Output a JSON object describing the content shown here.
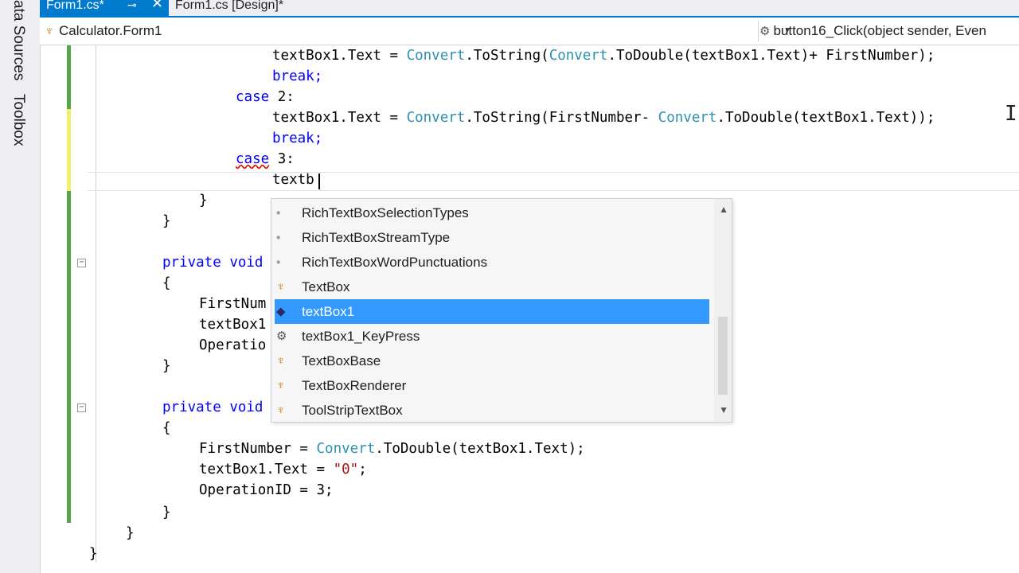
{
  "side_panel": {
    "tabs": [
      "ata Sources",
      "Toolbox"
    ]
  },
  "tabs": {
    "active_label": "Form1.cs*",
    "pin_icon": "pin-icon",
    "close_icon": "close-icon",
    "second_label": "Form1.cs [Design]*"
  },
  "nav": {
    "class_selector": "Calculator.Form1",
    "member_selector": "button16_Click(object sender, Even"
  },
  "code": {
    "l1a": "textBox1.Text = ",
    "l1b": "Convert",
    "l1c": ".ToString(",
    "l1d": "Convert",
    "l1e": ".ToDouble(textBox1.Text)+ FirstNumber);",
    "l2": "break;",
    "l3a": "case",
    "l3b": " 2:",
    "l4a": "textBox1.Text = ",
    "l4b": "Convert",
    "l4c": ".ToString(FirstNumber- ",
    "l4d": "Convert",
    "l4e": ".ToDouble(textBox1.Text));",
    "l5": "break;",
    "l6a": "case",
    "l6b": " 3:",
    "l7": "textb",
    "l8": "}",
    "l9": "}",
    "l10a": "private",
    "l10b": "void",
    "l11": "{",
    "l12": "FirstNum",
    "l13": "textBox1",
    "l14": "Operatio",
    "l15": "}",
    "l16a": "private",
    "l16b": "void",
    "l17": "{",
    "l18a": "FirstNumber = ",
    "l18b": "Convert",
    "l18c": ".ToDouble(textBox1.Text);",
    "l19a": "textBox1.Text = ",
    "l19b": "\"0\"",
    "l19c": ";",
    "l20": "OperationID = 3;",
    "l21": "}",
    "l22": "}",
    "l23": "}"
  },
  "completion": {
    "items": [
      {
        "label": "RichTextBoxSelectionTypes",
        "icon": "enum-icon",
        "glyph": "▪"
      },
      {
        "label": "RichTextBoxStreamType",
        "icon": "enum-icon",
        "glyph": "▪"
      },
      {
        "label": "RichTextBoxWordPunctuations",
        "icon": "enum-icon",
        "glyph": "▪"
      },
      {
        "label": "TextBox",
        "icon": "class-icon",
        "glyph": "♆"
      },
      {
        "label": "textBox1",
        "icon": "field-icon",
        "glyph": "◆"
      },
      {
        "label": "textBox1_KeyPress",
        "icon": "method-icon",
        "glyph": "⚙"
      },
      {
        "label": "TextBoxBase",
        "icon": "class-icon",
        "glyph": "♆"
      },
      {
        "label": "TextBoxRenderer",
        "icon": "class-icon",
        "glyph": "♆"
      },
      {
        "label": "ToolStripTextBox",
        "icon": "class-icon",
        "glyph": "♆"
      }
    ],
    "selected_index": 4
  },
  "colors": {
    "accent": "#007acc",
    "keyword": "#0000ff",
    "type": "#2b91af",
    "string": "#a31515",
    "selection": "#3399ff"
  }
}
